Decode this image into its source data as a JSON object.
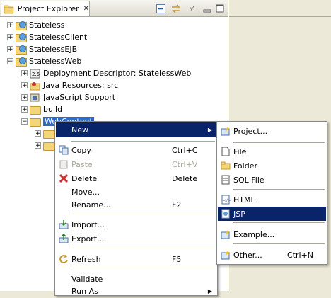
{
  "view": {
    "title": "Project Explorer"
  },
  "tree": [
    {
      "label": "Stateless",
      "expanded": false
    },
    {
      "label": "StatelessClient",
      "expanded": false
    },
    {
      "label": "StatelessEJB",
      "expanded": false
    },
    {
      "label": "StatelessWeb",
      "expanded": true
    },
    {
      "label": "Deployment Descriptor: StatelessWeb",
      "expanded": false
    },
    {
      "label": "Java Resources: src",
      "expanded": false
    },
    {
      "label": "JavaScript Support",
      "expanded": false
    },
    {
      "label": "build",
      "expanded": false
    },
    {
      "label": "WebContent",
      "expanded": true,
      "selected": true
    }
  ],
  "context_menu": [
    {
      "label": "New",
      "accelerator": "",
      "submenu": true,
      "highlighted": true
    },
    {
      "label": "Copy",
      "accelerator": "Ctrl+C"
    },
    {
      "label": "Paste",
      "accelerator": "Ctrl+V",
      "disabled": true
    },
    {
      "label": "Delete",
      "accelerator": "Delete"
    },
    {
      "label": "Move...",
      "accelerator": ""
    },
    {
      "label": "Rename...",
      "accelerator": "F2"
    },
    {
      "label": "Import...",
      "accelerator": ""
    },
    {
      "label": "Export...",
      "accelerator": ""
    },
    {
      "label": "Refresh",
      "accelerator": "F5"
    },
    {
      "label": "Validate",
      "accelerator": ""
    },
    {
      "label": "Run As",
      "accelerator": "",
      "submenu": true
    }
  ],
  "new_submenu": [
    {
      "label": "Project...",
      "accelerator": ""
    },
    {
      "label": "File",
      "accelerator": ""
    },
    {
      "label": "Folder",
      "accelerator": ""
    },
    {
      "label": "SQL File",
      "accelerator": ""
    },
    {
      "label": "HTML",
      "accelerator": ""
    },
    {
      "label": "JSP",
      "accelerator": "",
      "highlighted": true
    },
    {
      "label": "Example...",
      "accelerator": ""
    },
    {
      "label": "Other...",
      "accelerator": "Ctrl+N"
    }
  ],
  "colors": {
    "selection": "#316ac5",
    "menu_highlight": "#0a246a",
    "folder": "#f4d67a"
  },
  "icons": {
    "close": "close-icon",
    "collapse_all": "collapse-all-icon",
    "link_editor": "link-with-editor-icon",
    "view_menu": "view-menu-icon",
    "minimize": "minimize-icon",
    "maximize": "maximize-icon"
  }
}
